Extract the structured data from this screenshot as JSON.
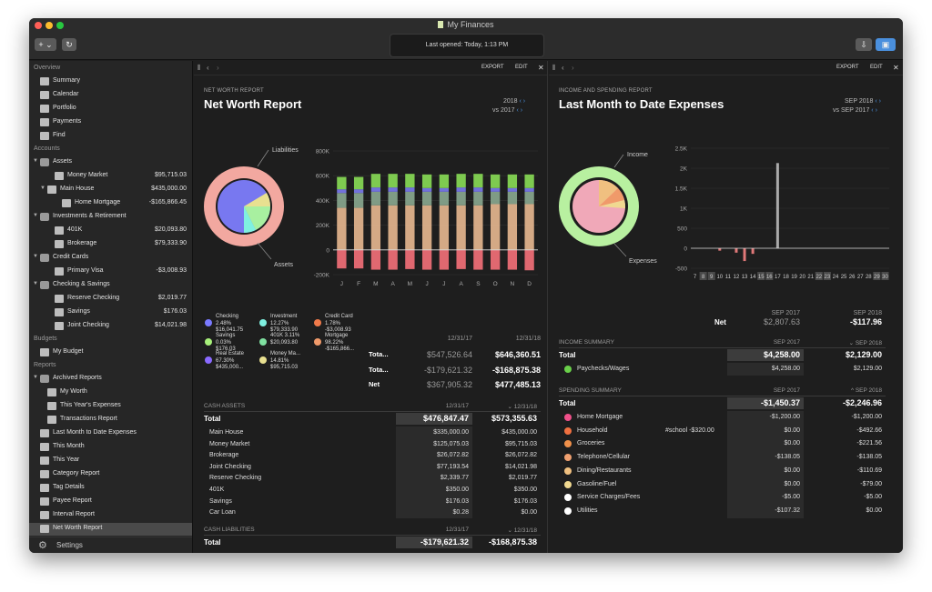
{
  "window": {
    "title": "My Finances",
    "status": "Last opened: Today, 1:13 PM",
    "add_label": "+ ⌄",
    "refresh_label": "↻",
    "colors": {
      "close": "#ff5f57",
      "minimize": "#febc2e",
      "zoom": "#28c840"
    }
  },
  "sidebar": {
    "overview_label": "Overview",
    "overview": [
      {
        "label": "Summary",
        "icon": "bank-icon"
      },
      {
        "label": "Calendar",
        "icon": "calendar-icon"
      },
      {
        "label": "Portfolio",
        "icon": "chart-icon"
      },
      {
        "label": "Payments",
        "icon": "payments-icon"
      },
      {
        "label": "Find",
        "icon": "find-icon"
      }
    ],
    "accounts_label": "Accounts",
    "accounts": [
      {
        "label": "Assets",
        "amount": "",
        "indent": 1,
        "icon": "folder-icon",
        "tri": "▼"
      },
      {
        "label": "Money Market",
        "amount": "$95,715.03",
        "indent": 3,
        "icon": "bank-icon",
        "tri": ""
      },
      {
        "label": "Main House",
        "amount": "$435,000.00",
        "indent": 2,
        "icon": "house-icon",
        "tri": "▼"
      },
      {
        "label": "Home Mortgage",
        "amount": "-$165,866.45",
        "indent": 4,
        "icon": "bank-icon",
        "tri": ""
      },
      {
        "label": "Investments & Retirement",
        "amount": "",
        "indent": 1,
        "icon": "folder-icon",
        "tri": "▼"
      },
      {
        "label": "401K",
        "amount": "$20,093.80",
        "indent": 3,
        "icon": "401k-icon",
        "tri": ""
      },
      {
        "label": "Brokerage",
        "amount": "$79,333.90",
        "indent": 3,
        "icon": "brokerage-icon",
        "tri": ""
      },
      {
        "label": "Credit Cards",
        "amount": "",
        "indent": 1,
        "icon": "folder-icon",
        "tri": "▼"
      },
      {
        "label": "Primary Visa",
        "amount": "-$3,008.93",
        "indent": 3,
        "icon": "card-icon",
        "tri": ""
      },
      {
        "label": "Checking & Savings",
        "amount": "",
        "indent": 1,
        "icon": "folder-icon",
        "tri": "▼"
      },
      {
        "label": "Reserve Checking",
        "amount": "$2,019.77",
        "indent": 3,
        "icon": "bank-icon",
        "tri": ""
      },
      {
        "label": "Savings",
        "amount": "$176.03",
        "indent": 3,
        "icon": "savings-icon",
        "tri": ""
      },
      {
        "label": "Joint Checking",
        "amount": "$14,021.98",
        "indent": 3,
        "icon": "bank-icon",
        "tri": ""
      }
    ],
    "budgets_label": "Budgets",
    "budgets": [
      {
        "label": "My Budget",
        "icon": "budget-icon"
      }
    ],
    "reports_label": "Reports",
    "reports": [
      {
        "label": "Archived Reports",
        "indent": 1,
        "icon": "folder-icon",
        "tri": "▼",
        "selected": false
      },
      {
        "label": "My Worth",
        "indent": 2,
        "icon": "report-icon",
        "tri": "",
        "selected": false
      },
      {
        "label": "This Year's Expenses",
        "indent": 2,
        "icon": "report-icon",
        "tri": "",
        "selected": false
      },
      {
        "label": "Transactions Report",
        "indent": 2,
        "icon": "report-icon",
        "tri": "",
        "selected": false
      },
      {
        "label": "Last Month to Date Expenses",
        "indent": 1,
        "icon": "report-icon",
        "tri": "",
        "selected": false
      },
      {
        "label": "This Month",
        "indent": 1,
        "icon": "report-icon",
        "tri": "",
        "selected": false
      },
      {
        "label": "This Year",
        "indent": 1,
        "icon": "report-icon",
        "tri": "",
        "selected": false
      },
      {
        "label": "Category Report",
        "indent": 1,
        "icon": "report-icon",
        "tri": "",
        "selected": false
      },
      {
        "label": "Tag Details",
        "indent": 1,
        "icon": "report-icon",
        "tri": "",
        "selected": false
      },
      {
        "label": "Payee Report",
        "indent": 1,
        "icon": "report-icon",
        "tri": "",
        "selected": false
      },
      {
        "label": "Interval Report",
        "indent": 1,
        "icon": "report-icon",
        "tri": "",
        "selected": false
      },
      {
        "label": "Net Worth Report",
        "indent": 1,
        "icon": "report-icon",
        "tri": "",
        "selected": true
      }
    ],
    "settings_label": "Settings"
  },
  "left_pane": {
    "export": "EXPORT",
    "edit": "EDIT",
    "caption": "NET WORTH REPORT",
    "title": "Net Worth Report",
    "year_a": "2018",
    "year_b": "vs  2017",
    "donut_label_top": "Liabilities",
    "donut_label_bottom": "Assets",
    "legend": [
      {
        "name": "Checking",
        "lines": [
          "2.48%",
          "$16,041.75"
        ],
        "color": "#7a7aff"
      },
      {
        "name": "Investment",
        "lines": [
          "12.27%",
          "$79,333.90"
        ],
        "color": "#7ff0e0"
      },
      {
        "name": "Credit Card",
        "lines": [
          "1.78%",
          "-$3,008.93"
        ],
        "color": "#f07a4a"
      },
      {
        "name": "Savings",
        "lines": [
          "0.03%",
          "$176.03"
        ],
        "color": "#a7f07a"
      },
      {
        "name": "401K 3.11%",
        "lines": [
          "$20,093.80"
        ],
        "color": "#7fe0a0"
      },
      {
        "name": "Mortgage",
        "lines": [
          "98.22%",
          "-$165,866..."
        ],
        "color": "#f09a6a"
      },
      {
        "name": "Real Estate",
        "lines": [
          "67.30%",
          "$435,000..."
        ],
        "color": "#8a6aff"
      },
      {
        "name": "Money Ma...",
        "lines": [
          "14.81%",
          "$95,715.03"
        ],
        "color": "#e8e090"
      }
    ],
    "summary": {
      "col1": "12/31/17",
      "col2": "12/31/18",
      "rows": [
        {
          "label": "Tota...",
          "v1": "$547,526.64",
          "v2": "$646,360.51"
        },
        {
          "label": "Tota...",
          "v1": "-$179,621.32",
          "v2": "-$168,875.38"
        },
        {
          "label": "Net",
          "v1": "$367,905.32",
          "v2": "$477,485.13"
        }
      ]
    },
    "cash_assets": {
      "title": "CASH ASSETS",
      "col1": "12/31/17",
      "col2": "⌄ 12/31/18",
      "total": {
        "label": "Total",
        "v1": "$476,847.47",
        "v2": "$573,355.63"
      },
      "rows": [
        {
          "label": "Main House",
          "v1": "$335,000.00",
          "v2": "$435,000.00"
        },
        {
          "label": "Money Market",
          "v1": "$125,075.03",
          "v2": "$95,715.03"
        },
        {
          "label": "Brokerage",
          "v1": "$26,072.82",
          "v2": "$26,072.82"
        },
        {
          "label": "Joint Checking",
          "v1": "$77,193.54",
          "v2": "$14,021.98"
        },
        {
          "label": "Reserve Checking",
          "v1": "$2,339.77",
          "v2": "$2,019.77"
        },
        {
          "label": "401K",
          "v1": "$350.00",
          "v2": "$350.00"
        },
        {
          "label": "Savings",
          "v1": "$176.03",
          "v2": "$176.03"
        },
        {
          "label": "Car Loan",
          "v1": "$0.28",
          "v2": "$0.00"
        }
      ]
    },
    "cash_liabilities": {
      "title": "CASH LIABILITIES",
      "col1": "12/31/17",
      "col2": "⌄ 12/31/18",
      "total": {
        "label": "Total",
        "v1": "-$179,621.32",
        "v2": "-$168,875.38"
      }
    }
  },
  "right_pane": {
    "export": "EXPORT",
    "edit": "EDIT",
    "caption": "INCOME AND SPENDING REPORT",
    "title": "Last Month to Date Expenses",
    "period_a": "SEP 2018",
    "period_b": "vs  SEP 2017",
    "donut_label_top": "Income",
    "donut_label_bottom": "Expenses",
    "net": {
      "label": "Net",
      "col1": "SEP 2017",
      "col2": "SEP 2018",
      "v1": "$2,807.63",
      "v2": "-$117.96"
    },
    "income": {
      "title": "INCOME SUMMARY",
      "col1": "SEP 2017",
      "col2": "⌄ SEP 2018",
      "total": {
        "label": "Total",
        "v1": "$4,258.00",
        "v2": "$2,129.00"
      },
      "rows": [
        {
          "label": "Paychecks/Wages",
          "tag": "",
          "v1": "$4,258.00",
          "v2": "$2,129.00",
          "color": "#6ad04a"
        }
      ]
    },
    "spending": {
      "title": "SPENDING SUMMARY",
      "col1": "SEP 2017",
      "col2": "^ SEP 2018",
      "total": {
        "label": "Total",
        "v1": "-$1,450.37",
        "v2": "-$2,246.96"
      },
      "rows": [
        {
          "label": "Home Mortgage",
          "tag": "",
          "v1": "-$1,200.00",
          "v2": "-$1,200.00",
          "color": "#f0508a"
        },
        {
          "label": "Household",
          "tag": "#school -$320.00",
          "v1": "$0.00",
          "v2": "-$492.66",
          "color": "#f07040"
        },
        {
          "label": "Groceries",
          "tag": "",
          "v1": "$0.00",
          "v2": "-$221.56",
          "color": "#f0904a"
        },
        {
          "label": "Telephone/Cellular",
          "tag": "",
          "v1": "-$138.05",
          "v2": "-$138.05",
          "color": "#f0a070"
        },
        {
          "label": "Dining/Restaurants",
          "tag": "",
          "v1": "$0.00",
          "v2": "-$110.69",
          "color": "#f0c080"
        },
        {
          "label": "Gasoline/Fuel",
          "tag": "",
          "v1": "$0.00",
          "v2": "-$79.00",
          "color": "#f0d890"
        },
        {
          "label": "Service Charges/Fees",
          "tag": "",
          "v1": "-$5.00",
          "v2": "-$5.00",
          "color": "#ffffff"
        },
        {
          "label": "Utilities",
          "tag": "",
          "v1": "-$107.32",
          "v2": "$0.00",
          "color": "#ffffff"
        }
      ]
    }
  },
  "chart_data": [
    {
      "type": "bar",
      "ylim": [
        -200000,
        800000
      ],
      "yticks": [
        "800K",
        "600K",
        "400K",
        "200K",
        "0",
        "-200K"
      ],
      "categories": [
        "J",
        "F",
        "M",
        "A",
        "M",
        "J",
        "J",
        "A",
        "S",
        "O",
        "N",
        "D"
      ],
      "series": [
        {
          "color": "#e06870",
          "values": [
            -150000,
            -150000,
            -160000,
            -160000,
            -155000,
            -160000,
            -160000,
            -155000,
            -160000,
            -160000,
            -160000,
            -165000
          ]
        },
        {
          "color": "#e8b890",
          "values": [
            340000,
            340000,
            360000,
            360000,
            360000,
            360000,
            360000,
            360000,
            360000,
            370000,
            370000,
            370000
          ]
        },
        {
          "color": "#8aa890",
          "values": [
            120000,
            120000,
            110000,
            110000,
            110000,
            110000,
            110000,
            110000,
            110000,
            100000,
            100000,
            100000
          ]
        },
        {
          "color": "#7a7af0",
          "values": [
            30000,
            30000,
            35000,
            35000,
            35000,
            30000,
            30000,
            35000,
            35000,
            30000,
            30000,
            30000
          ]
        },
        {
          "color": "#88dd55",
          "values": [
            100000,
            100000,
            110000,
            110000,
            110000,
            110000,
            110000,
            110000,
            110000,
            110000,
            110000,
            110000
          ]
        }
      ]
    },
    {
      "type": "bar",
      "ylim": [
        -500,
        2500
      ],
      "yticks": [
        "2.5K",
        "2K",
        "1.5K",
        "1K",
        "500",
        "0",
        "-500"
      ],
      "categories": [
        "7",
        "8",
        "9",
        "10",
        "11",
        "12",
        "13",
        "14",
        "15",
        "16",
        "17",
        "18",
        "19",
        "20",
        "21",
        "22",
        "23",
        "24",
        "25",
        "26",
        "27",
        "28",
        "29",
        "30"
      ],
      "highlight": [
        "8",
        "9",
        "15",
        "16",
        "22",
        "23",
        "29",
        "30"
      ],
      "values": [
        0,
        0,
        0,
        -60,
        0,
        -110,
        -320,
        -140,
        0,
        0,
        2129,
        0,
        0,
        0,
        0,
        0,
        0,
        0,
        0,
        0,
        0,
        0,
        0,
        0
      ]
    }
  ]
}
